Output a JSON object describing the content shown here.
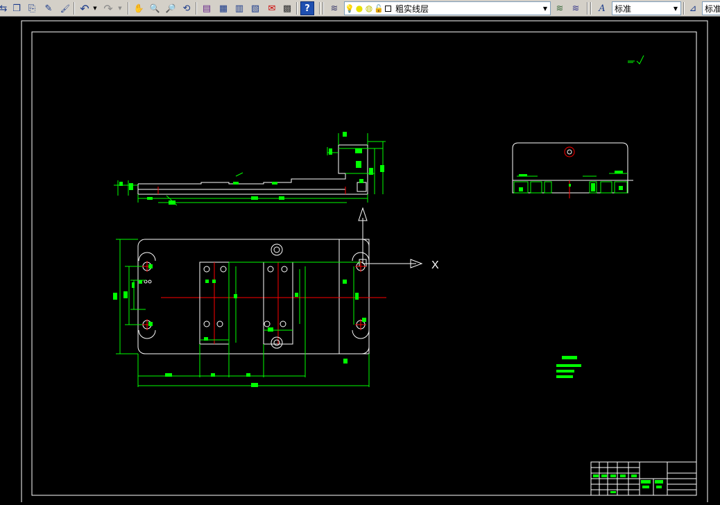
{
  "toolbar": {
    "buttons": [
      {
        "name": "match-properties-icon",
        "glyph": "⇆"
      },
      {
        "name": "copy-icon",
        "glyph": "❐"
      },
      {
        "name": "paste-icon",
        "glyph": "⎘"
      },
      {
        "name": "brush-icon",
        "glyph": "✎"
      },
      {
        "name": "match-brush-icon",
        "glyph": "🖌"
      },
      {
        "name": "undo-icon",
        "glyph": "↶"
      },
      {
        "name": "redo-icon",
        "glyph": "↷"
      },
      {
        "name": "pan-icon",
        "glyph": "✋"
      },
      {
        "name": "zoom-realtime-icon",
        "glyph": "🔍"
      },
      {
        "name": "zoom-window-icon",
        "glyph": "🔎"
      },
      {
        "name": "zoom-previous-icon",
        "glyph": "⟲"
      },
      {
        "name": "properties-icon",
        "glyph": "▤"
      },
      {
        "name": "design-center-icon",
        "glyph": "▦"
      },
      {
        "name": "tool-palette-icon",
        "glyph": "▥"
      },
      {
        "name": "sheet-set-icon",
        "glyph": "▧"
      },
      {
        "name": "markup-icon",
        "glyph": "✉"
      },
      {
        "name": "calculator-icon",
        "glyph": "▩"
      },
      {
        "name": "help-icon",
        "glyph": "?"
      }
    ],
    "layer_combo": {
      "value": "粗实线层"
    },
    "text_style_combo": {
      "value": "标准"
    },
    "dim_style_combo": {
      "value": "标准"
    }
  },
  "drawing": {
    "ucs_x_label": "X"
  },
  "colors": {
    "background": "#000000",
    "border": "#ffffff",
    "dimension": "#00ff00",
    "centerline": "#ff0000",
    "toolbar": "#d4d0c8"
  }
}
